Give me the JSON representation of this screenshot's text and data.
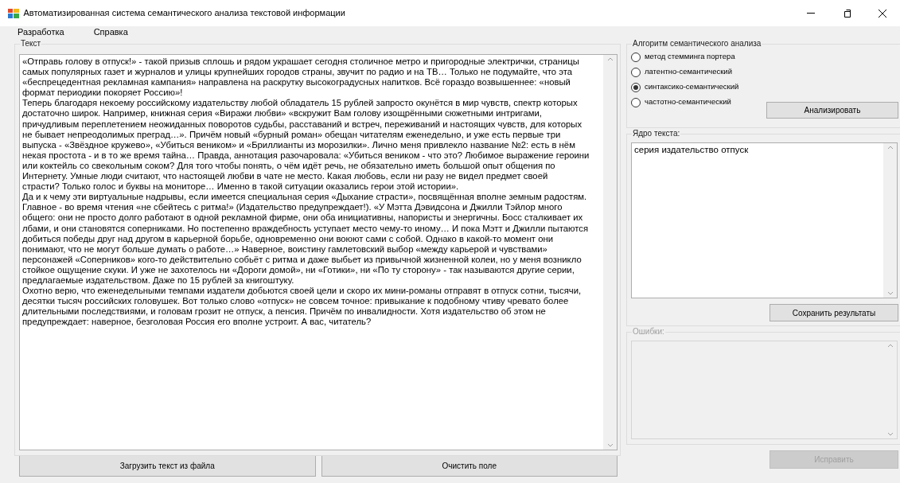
{
  "window": {
    "title": "Автоматизированная система семантического анализа текстовой информации"
  },
  "menu": [
    "Разработка",
    "Справка"
  ],
  "text_group": {
    "label": "Текст",
    "lines": [
      "«Отправь голову в отпуск!» - такой призыв сплошь и рядом украшает сегодня столичное метро и пригородные электрички, страницы",
      "самых популярных газет и журналов и улицы крупнейших городов страны, звучит по радио и на ТВ… Только не подумайте, что эта",
      "«беспрецедентная рекламная кампания» направлена на раскрутку высокоградусных напитков. Всё гораздо возвышеннее: «новый",
      "формат периодики покоряет Россию»!",
      "Теперь благодаря некоему российскому издательству любой обладатель 15 рублей запросто окунётся в мир чувств, спектр которых",
      "достаточно широк. Например, книжная серия «Виражи любви» «вскружит Вам голову изощрёнными сюжетными интригами,",
      "причудливым переплетением неожиданных поворотов судьбы, расставаний и встреч, переживаний и настоящих чувств, для которых",
      "не бывает непреодолимых преград…». Причём новый «бурный роман» обещан читателям еженедельно, и уже есть первые три",
      "выпуска - «Звёздное кружево», «Убиться веником» и «Бриллианты из морозилки». Лично меня привлекло название №2: есть в нём",
      "некая простота - и в то же время тайна… Правда, аннотация разочаровала: «Убиться веником - что это? Любимое выражение героини",
      "или коктейль со свекольным соком? Для того чтобы понять, о чём идёт речь, не обязательно иметь большой опыт общения по",
      "Интернету. Умные люди считают, что настоящей любви в чате не место. Какая любовь, если ни разу не видел предмет своей",
      "страсти? Только голос и буквы на мониторе… Именно в такой ситуации оказались герои этой истории».",
      "Да и к чему эти виртуальные надрывы, если имеется специальная серия «Дыхание страсти», посвящённая вполне земным радостям.",
      "Главное - во время чтения «не сбейтесь с ритма!» (Издательство предупреждает!). «У Мэтта Дэвидсона и Джилли Тэйлор много",
      "общего: они не просто долго работают в одной рекламной фирме, они оба инициативны, напористы и энергичны. Босс сталкивает их",
      "лбами, и они становятся соперниками. Но постепенно враждебность уступает место чему-то иному… И пока Мэтт и Джилли пытаются",
      "добиться победы друг над другом в карьерной борьбе, одновременно они воюют сами с собой. Однако в какой-то момент они",
      "понимают, что не могут больше думать о работе…» Наверное, воистину гамлетовский выбор «между карьерой и чувствами»",
      "персонажей «Соперников» кого-то действительно собьёт с ритма и даже выбьет из привычной жизненной колеи, но у меня возникло",
      "стойкое ощущение скуки. И уже не захотелось ни «Дороги домой», ни «Готики», ни «По ту сторону» - так называются другие серии,",
      "предлагаемые издательством. Даже по 15 рублей за книгоштуку.",
      "Охотно верю, что еженедельными темпами издатели добьются своей цели и скоро их мини-романы отправят в отпуск сотни, тысячи,",
      "десятки тысяч российских головушек. Вот только слово «отпуск» не совсем точное: привыкание к подобному чтиву чревато более",
      "длительными последствиями, и головам грозит не отпуск, а пенсия. Причём по инвалидности. Хотя издательство об этом не",
      "предупреждает: наверное, безголовая Россия его вполне устроит. А вас, читатель?"
    ]
  },
  "text_buttons": [
    {
      "label": "Загрузить текст из файла",
      "disabled": false
    },
    {
      "label": "Очистить поле",
      "disabled": false
    }
  ],
  "algorithm": {
    "label": "Алгоритм семантического анализа",
    "options": [
      {
        "label": "метод стемминга портера",
        "selected": false
      },
      {
        "label": "латентно-семантический",
        "selected": false
      },
      {
        "label": "синтаксико-семантический",
        "selected": true
      },
      {
        "label": "частотно-семантический",
        "selected": false
      }
    ],
    "button": {
      "label": "Анализировать",
      "disabled": false
    }
  },
  "core": {
    "label": "Ядро текста:",
    "value": "серия издательство отпуск",
    "button": {
      "label": "Сохранить результаты",
      "disabled": false
    }
  },
  "errors": {
    "label": "Ошибки:",
    "disabled": true,
    "button": {
      "label": "Исправить",
      "disabled": true
    }
  }
}
